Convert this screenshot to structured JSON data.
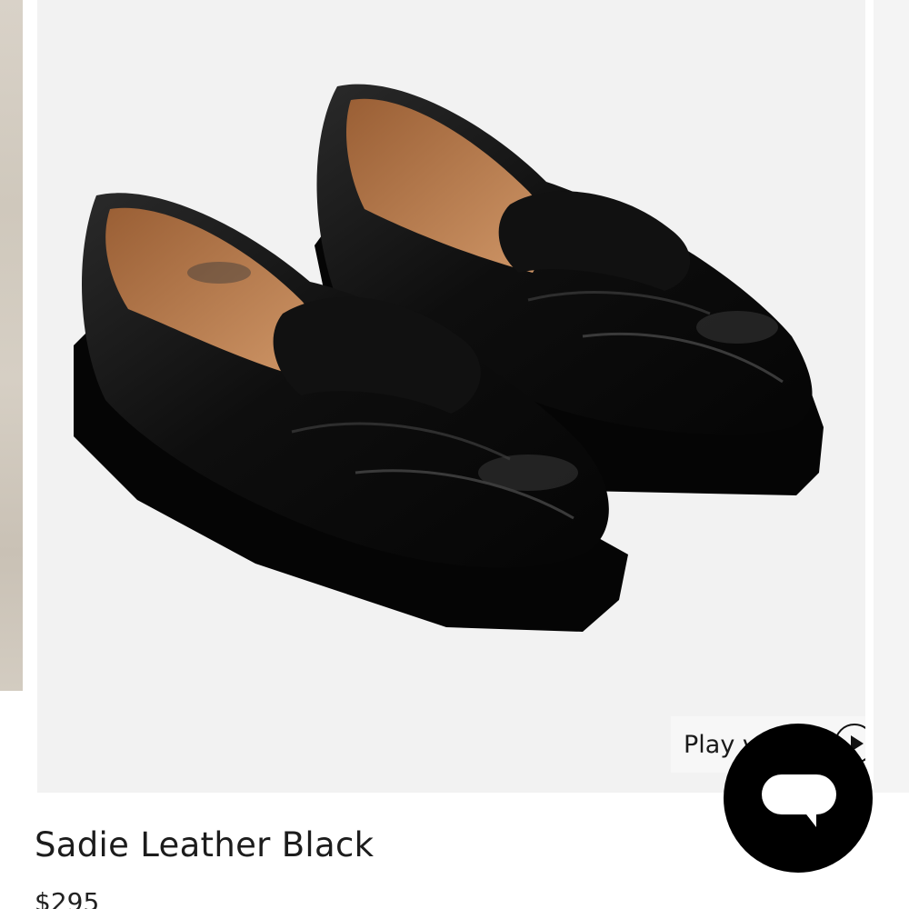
{
  "product": {
    "title": "Sadie Leather Black",
    "price": "$295",
    "image_description": "pair of black leather penny loafers"
  },
  "video": {
    "label": "Play v",
    "icon": "play-icon"
  },
  "chat": {
    "icon": "chat-bubble-icon"
  },
  "colors": {
    "card_background": "#f2f2f2",
    "leather": "#0d0d0d",
    "lining": "#b5784a",
    "chat_button": "#000000"
  }
}
